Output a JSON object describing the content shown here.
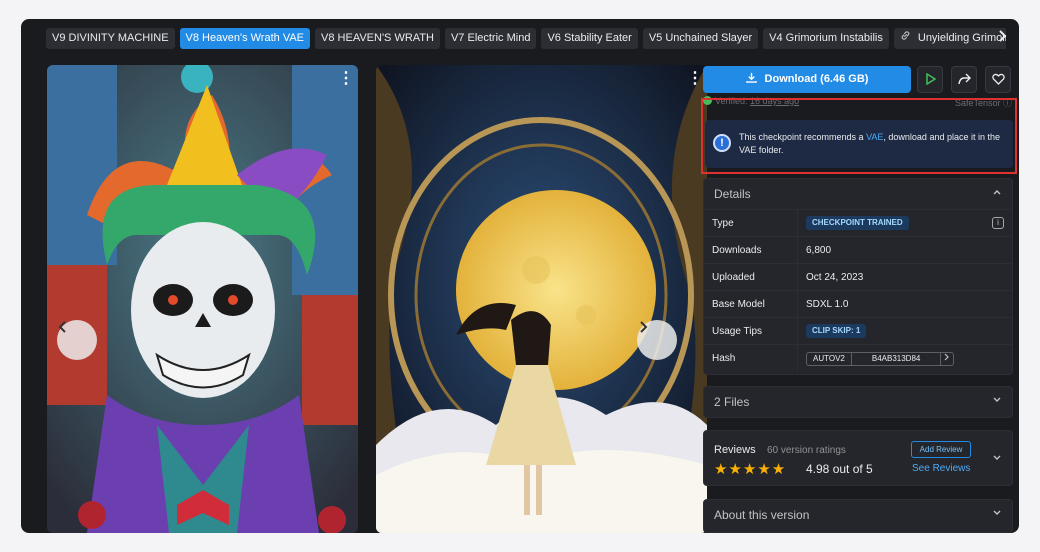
{
  "tabs": [
    {
      "label": "V9 DIVINITY MACHINE",
      "active": false
    },
    {
      "label": "V8 Heaven's Wrath VAE",
      "active": true
    },
    {
      "label": "V8 HEAVEN'S WRATH",
      "active": false
    },
    {
      "label": "V7 Electric Mind",
      "active": false
    },
    {
      "label": "V6 Stability Eater",
      "active": false
    },
    {
      "label": "V5 Unchained Slayer",
      "active": false
    },
    {
      "label": "V4 Grimorium Instabilis",
      "active": false
    }
  ],
  "last_tab": {
    "label": "Unyielding Grimoire + VA",
    "fade": "E",
    "icon": "link-icon"
  },
  "tabs_next_icon": "chevron-right-icon",
  "gallery": {
    "prev_icon": "chevron-left-icon",
    "next_icon": "chevron-right-icon",
    "menu_icon": "kebab-icon"
  },
  "download": {
    "label": "Download (6.46 GB)",
    "icon": "download-icon"
  },
  "actions": {
    "play_icon": "play-icon",
    "share_icon": "share-icon",
    "like_icon": "heart-icon"
  },
  "verified": {
    "prefix": "Verified:",
    "time": "16 days ago",
    "right": "SafeTensor"
  },
  "alert": {
    "before": "This checkpoint recommends a ",
    "link": "VAE",
    "after": ", download and place it in the VAE folder."
  },
  "details": {
    "title": "Details",
    "rows": {
      "type": {
        "key": "Type",
        "value": "CHECKPOINT TRAINED"
      },
      "downloads": {
        "key": "Downloads",
        "value": "6,800"
      },
      "uploaded": {
        "key": "Uploaded",
        "value": "Oct 24, 2023"
      },
      "base_model": {
        "key": "Base Model",
        "value": "SDXL 1.0"
      },
      "usage_tips": {
        "key": "Usage Tips",
        "value": "CLIP SKIP: 1"
      },
      "hash": {
        "key": "Hash",
        "algo": "AUTOV2",
        "value": "B4AB313D84"
      }
    }
  },
  "files": {
    "title": "2 Files"
  },
  "reviews": {
    "title": "Reviews",
    "count": "60 version ratings",
    "score": "4.98 out of 5",
    "stars": "★★★★★",
    "add_label": "Add Review",
    "see_label": "See Reviews"
  },
  "about": {
    "title": "About this version"
  },
  "colors": {
    "accent": "#228be6",
    "alert_border": "#e03131",
    "star": "#fab005",
    "verified": "#40c057"
  }
}
